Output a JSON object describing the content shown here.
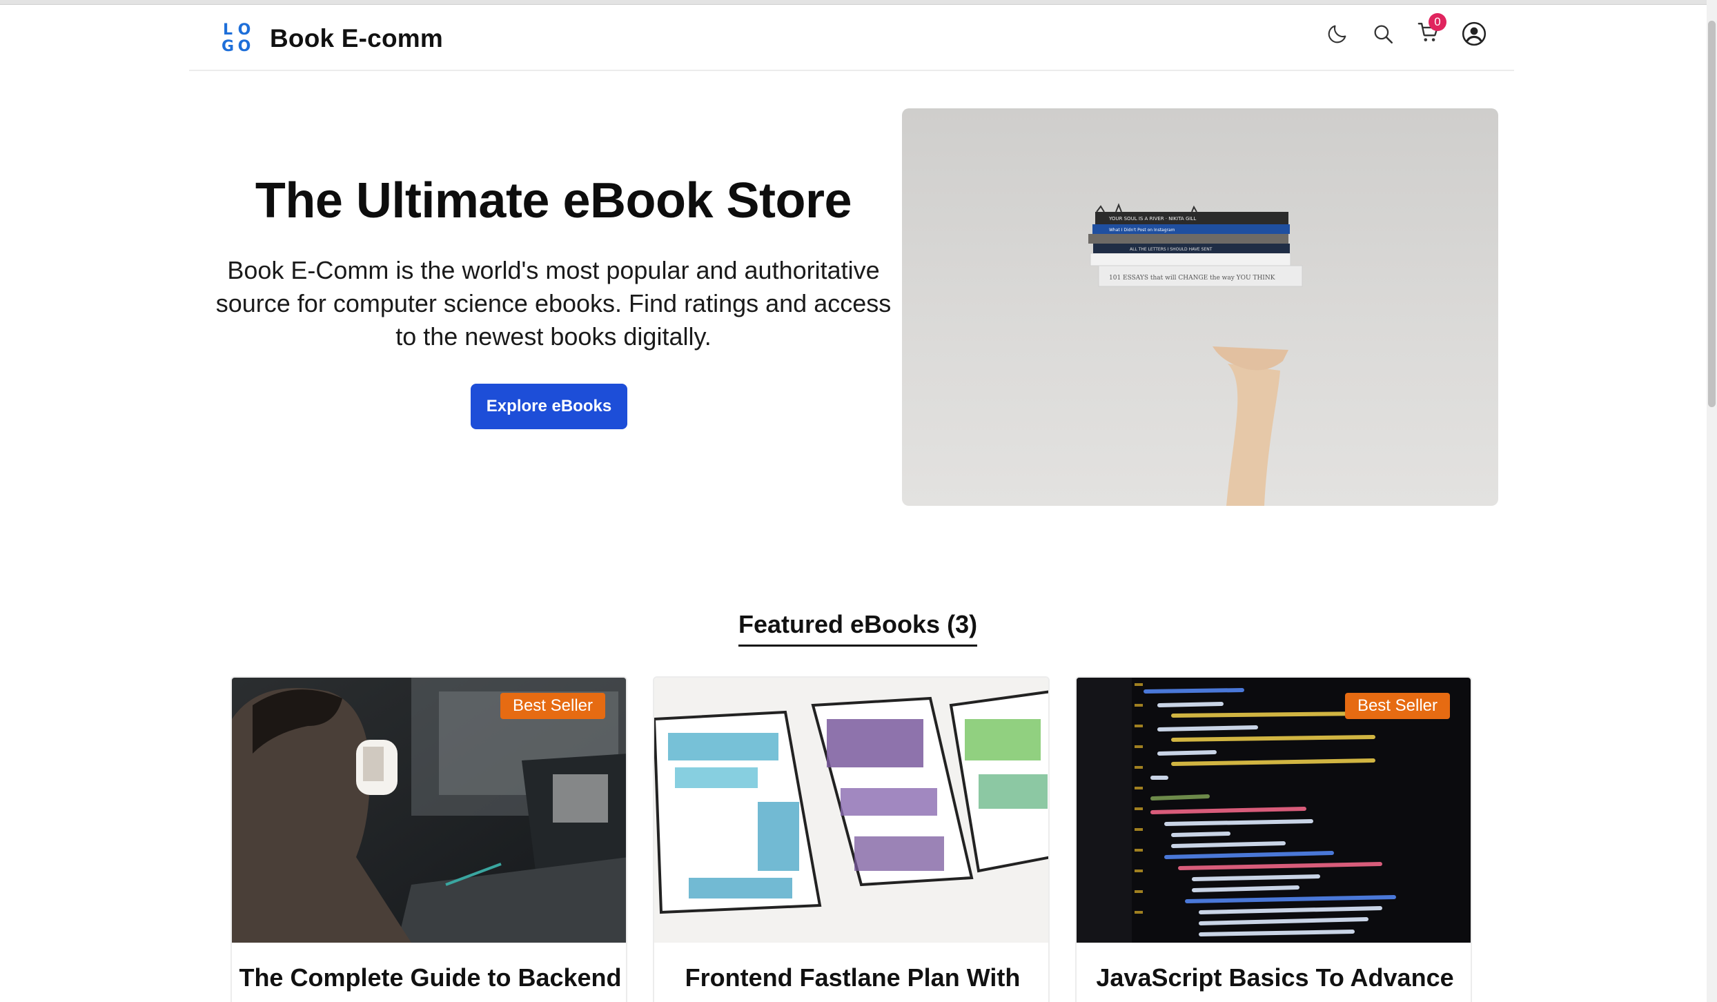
{
  "header": {
    "logo_letters": [
      "L",
      "O",
      "G",
      "O"
    ],
    "brand": "Book E-comm",
    "cart_count": "0",
    "icons": [
      "moon-icon",
      "search-icon",
      "cart-icon",
      "user-account-icon"
    ]
  },
  "hero": {
    "title": "The Ultimate eBook Store",
    "description_lines": [
      "Book E-Comm is the world's most popular and authoritative",
      "source for computer science ebooks. Find ratings and access",
      "to the newest books digitally."
    ],
    "button_label": "Explore eBooks",
    "image_books": [
      "YOUR SOUL IS A RIVER · NIKITA GILL",
      "What I Didn't Post on Instagram",
      "ALL THE LETTERS I SHOULD HAVE SENT",
      "101 ESSAYS that will CHANGE the way YOU THINK"
    ]
  },
  "featured": {
    "heading": "Featured eBooks (3)",
    "cards": [
      {
        "title": "The Complete Guide to Backend",
        "badge": "Best Seller"
      },
      {
        "title": "Frontend Fastlane Plan With",
        "badge": ""
      },
      {
        "title": "JavaScript Basics To Advance",
        "badge": "Best Seller"
      }
    ]
  },
  "colors": {
    "primary_button": "#1d4ed8",
    "badge": "#e66b12",
    "cart_badge": "#e0245e",
    "logo": "#1e6fd9"
  }
}
